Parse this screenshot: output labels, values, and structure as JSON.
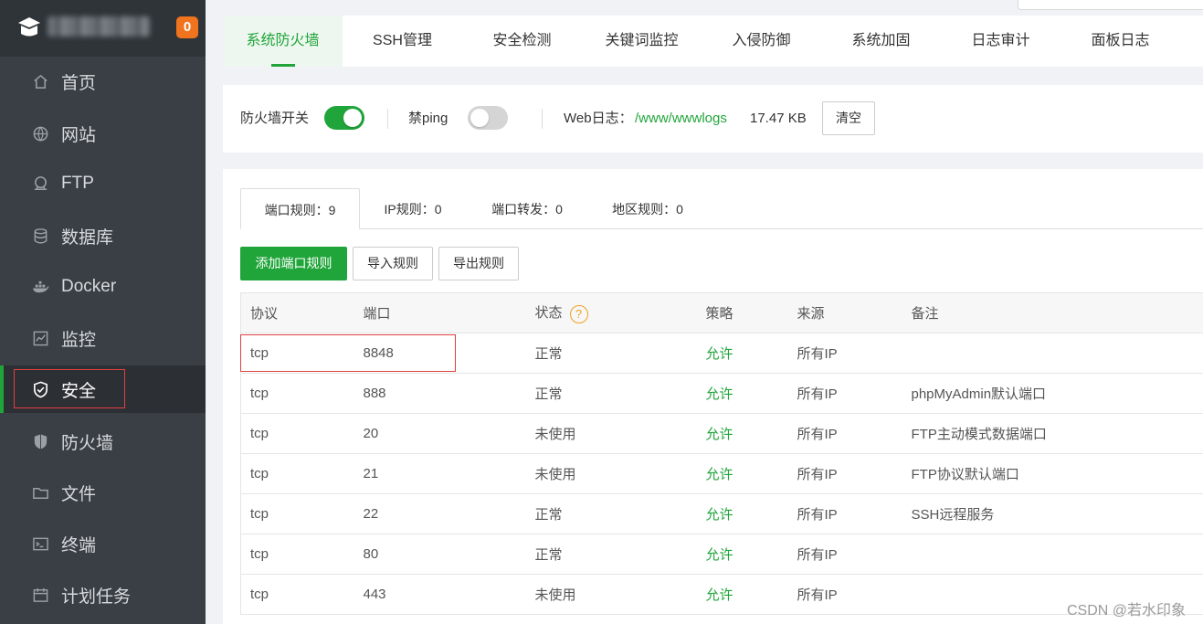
{
  "sidebar": {
    "badge": "0",
    "items": [
      {
        "label": "首页",
        "icon": "home-icon"
      },
      {
        "label": "网站",
        "icon": "globe-icon"
      },
      {
        "label": "FTP",
        "icon": "ftp-icon"
      },
      {
        "label": "数据库",
        "icon": "database-icon"
      },
      {
        "label": "Docker",
        "icon": "docker-icon"
      },
      {
        "label": "监控",
        "icon": "monitor-icon"
      },
      {
        "label": "安全",
        "icon": "shield-check-icon",
        "active": true
      },
      {
        "label": "防火墙",
        "icon": "firewall-shield-icon"
      },
      {
        "label": "文件",
        "icon": "folder-icon"
      },
      {
        "label": "终端",
        "icon": "terminal-icon"
      },
      {
        "label": "计划任务",
        "icon": "calendar-icon"
      }
    ]
  },
  "top_tabs": [
    "系统防火墙",
    "SSH管理",
    "安全检测",
    "关键词监控",
    "入侵防御",
    "系统加固",
    "日志审计",
    "面板日志"
  ],
  "settings": {
    "firewall_label": "防火墙开关",
    "firewall_on": true,
    "ping_label": "禁ping",
    "ping_on": false,
    "weblog_label": "Web日志：",
    "weblog_path": "/www/wwwlogs",
    "weblog_size": "17.47 KB",
    "clear_button": "清空"
  },
  "sub_tabs": [
    "端口规则：9",
    "IP规则：0",
    "端口转发：0",
    "地区规则：0"
  ],
  "buttons": {
    "add": "添加端口规则",
    "import": "导入规则",
    "export": "导出规则"
  },
  "table": {
    "headers": [
      "协议",
      "端口",
      "状态",
      "策略",
      "来源",
      "备注"
    ],
    "help_glyph": "?",
    "rows": [
      [
        "tcp",
        "8848",
        "正常",
        "允许",
        "所有IP",
        ""
      ],
      [
        "tcp",
        "888",
        "正常",
        "允许",
        "所有IP",
        "phpMyAdmin默认端口"
      ],
      [
        "tcp",
        "20",
        "未使用",
        "允许",
        "所有IP",
        "FTP主动模式数据端口"
      ],
      [
        "tcp",
        "21",
        "未使用",
        "允许",
        "所有IP",
        "FTP协议默认端口"
      ],
      [
        "tcp",
        "22",
        "正常",
        "允许",
        "所有IP",
        "SSH远程服务"
      ],
      [
        "tcp",
        "80",
        "正常",
        "允许",
        "所有IP",
        ""
      ],
      [
        "tcp",
        "443",
        "未使用",
        "允许",
        "所有IP",
        ""
      ]
    ]
  },
  "watermark": "CSDN @若水印象",
  "colors": {
    "accent": "#20a53a",
    "sidebar": "#3a3f45",
    "badge": "#f0731e",
    "highlight_box": "#e04040"
  }
}
